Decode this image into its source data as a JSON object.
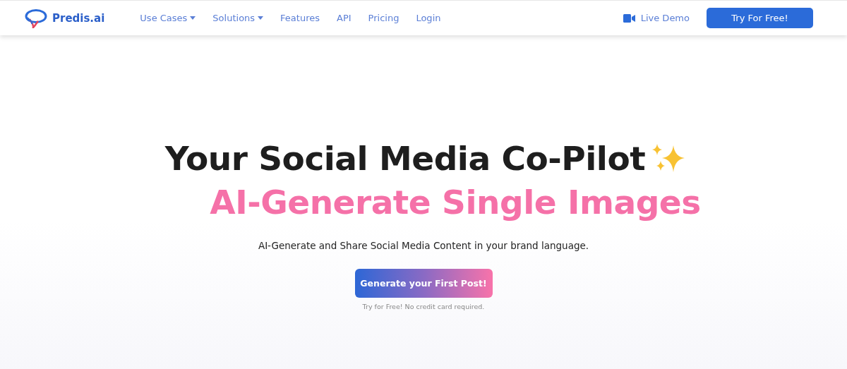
{
  "logo": {
    "text": "Predis.ai"
  },
  "nav": [
    {
      "label": "Use Cases",
      "kind": "dropdown"
    },
    {
      "label": "Solutions",
      "kind": "dropdown"
    },
    {
      "label": "Features",
      "kind": "link"
    },
    {
      "label": "API",
      "kind": "link"
    },
    {
      "label": "Pricing",
      "kind": "link"
    },
    {
      "label": "Login",
      "kind": "link"
    }
  ],
  "live_demo": "Live Demo",
  "cta_button": "Try For Free!",
  "hero": {
    "title": "Your Social Media Co-Pilot",
    "subtitle": "AI-Generate Single Images",
    "description": "AI-Generate and Share Social Media Content in your brand language.",
    "button": "Generate your First Post!",
    "note": "Try for Free! No credit card required."
  }
}
